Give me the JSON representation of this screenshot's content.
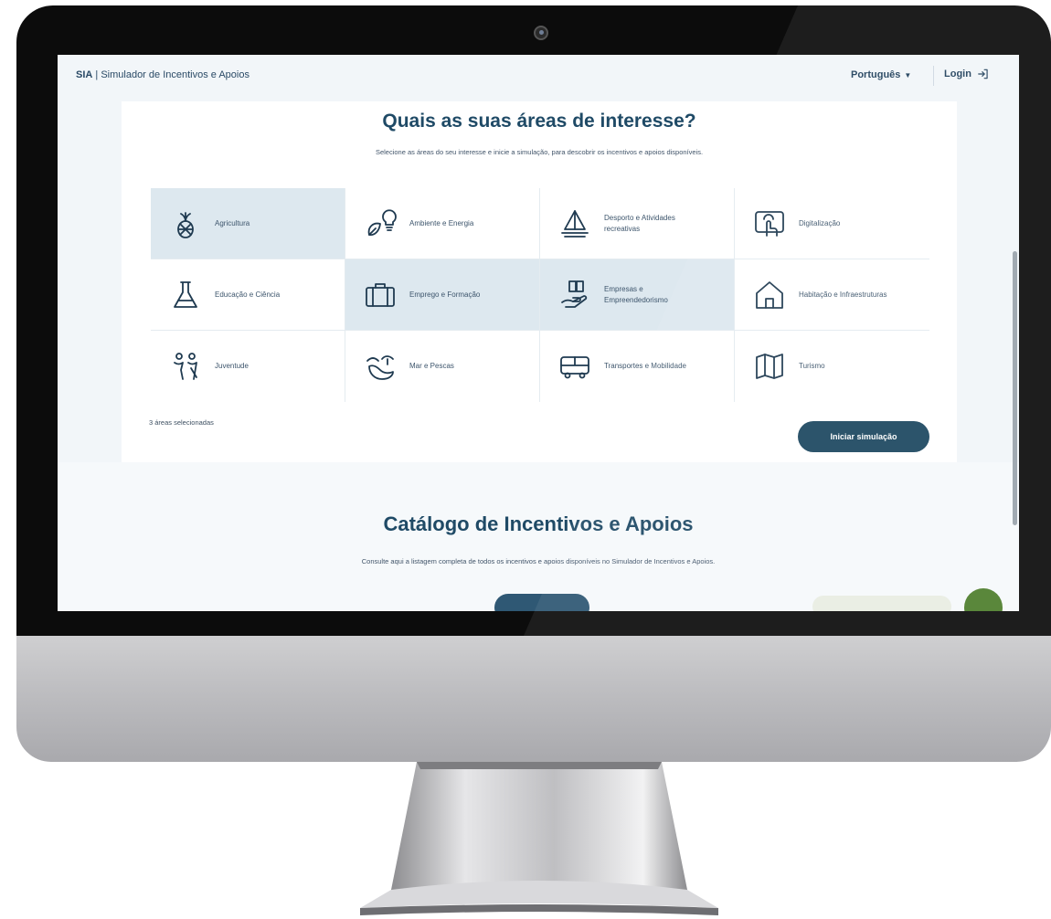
{
  "header": {
    "brand_short": "SIA",
    "brand_separator": "|",
    "brand_name": "Simulador de Incentivos e Apoios",
    "language": "Português",
    "login": "Login"
  },
  "interests": {
    "title": "Quais as suas áreas de interesse?",
    "subtitle": "Selecione as áreas do seu interesse e inicie a simulação, para descobrir os incentivos e apoios disponíveis.",
    "areas": [
      {
        "label": "Agricultura",
        "icon": "pineapple-icon",
        "selected": true
      },
      {
        "label": "Ambiente e Energia",
        "icon": "eco-bulb-icon",
        "selected": false
      },
      {
        "label": "Desporto e Atividades recreativas",
        "icon": "sailboat-icon",
        "selected": false
      },
      {
        "label": "Digitalização",
        "icon": "touch-screen-icon",
        "selected": false
      },
      {
        "label": "Educação e Ciência",
        "icon": "flask-icon",
        "selected": false
      },
      {
        "label": "Emprego e Formação",
        "icon": "briefcase-icon",
        "selected": true
      },
      {
        "label": "Empresas e Empreendedorismo",
        "icon": "hand-docs-icon",
        "selected": true
      },
      {
        "label": "Habitação e Infraestruturas",
        "icon": "house-icon",
        "selected": false
      },
      {
        "label": "Juventude",
        "icon": "people-icon",
        "selected": false
      },
      {
        "label": "Mar e Pescas",
        "icon": "fish-wave-icon",
        "selected": false
      },
      {
        "label": "Transportes e Mobilidade",
        "icon": "bus-icon",
        "selected": false
      },
      {
        "label": "Turismo",
        "icon": "map-icon",
        "selected": false
      }
    ],
    "selected_count_text": "3 áreas selecionadas",
    "start_button": "Iniciar simulação"
  },
  "catalog": {
    "title": "Catálogo de Incentivos e Apoios",
    "subtitle": "Consulte aqui a listagem completa de todos os incentivos e apoios disponíveis no Simulador de Incentivos e Apoios."
  },
  "colors": {
    "accent": "#1d4860",
    "title": "#1f4a66",
    "selected_tile": "#dde8ef",
    "chat_button": "#4e7e2d"
  }
}
